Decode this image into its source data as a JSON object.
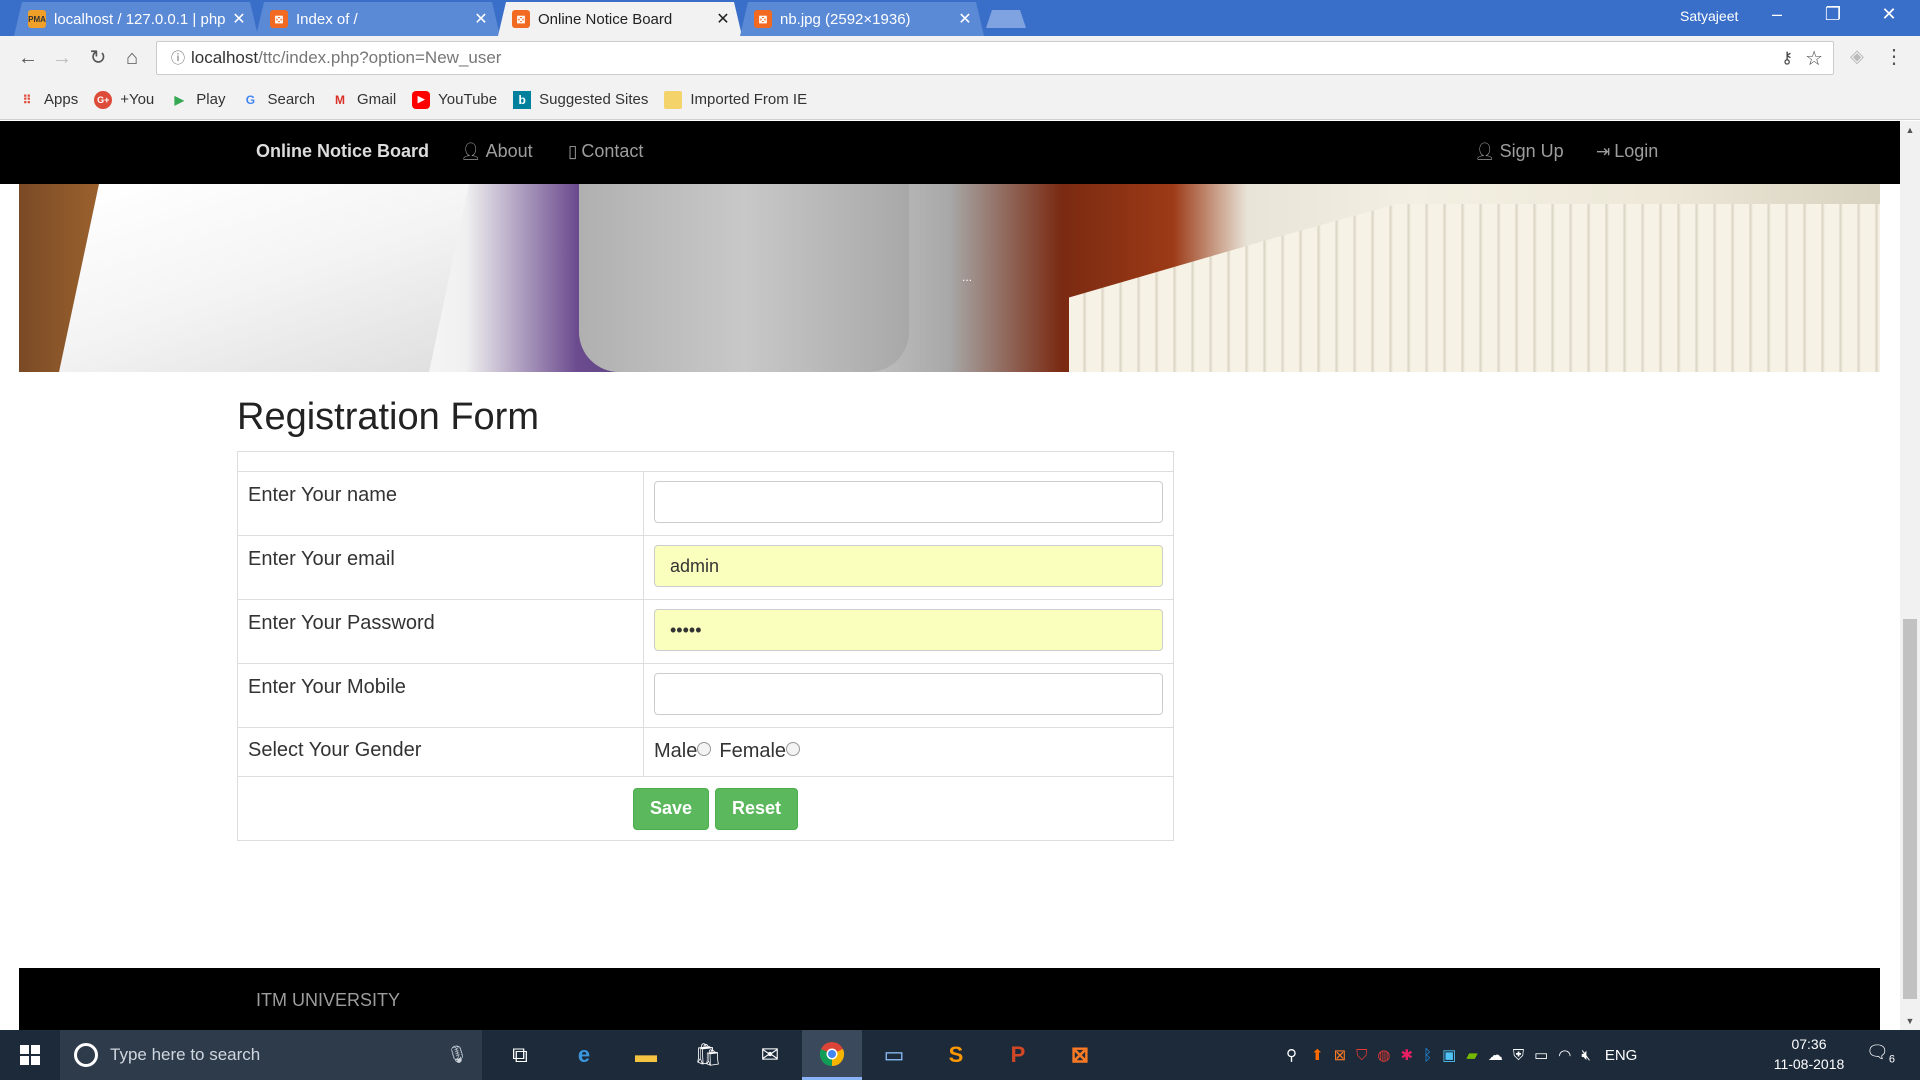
{
  "browser": {
    "tabs": [
      {
        "title": "localhost / 127.0.0.1 | php",
        "favicon": "phpmyadmin-icon",
        "active": false
      },
      {
        "title": "Index of /",
        "favicon": "xampp-icon",
        "active": false
      },
      {
        "title": "Online Notice Board",
        "favicon": "xampp-icon",
        "active": true
      },
      {
        "title": "nb.jpg (2592×1936)",
        "favicon": "xampp-icon",
        "active": false
      }
    ],
    "profile_name": "Satyajeet",
    "url_host": "localhost",
    "url_path": "/ttc/index.php?option=New_user",
    "bookmarks": [
      {
        "label": "Apps",
        "icon": "apps-grid-icon",
        "color": "#e04a3a"
      },
      {
        "label": "+You",
        "icon": "google-plus-icon",
        "color": "#dd4b39"
      },
      {
        "label": "Play",
        "icon": "play-store-icon",
        "color": "#34a853"
      },
      {
        "label": "Search",
        "icon": "google-g-icon",
        "color": "#4285f4"
      },
      {
        "label": "Gmail",
        "icon": "gmail-icon",
        "color": "#d93025"
      },
      {
        "label": "YouTube",
        "icon": "youtube-icon",
        "color": "#ff0000"
      },
      {
        "label": "Suggested Sites",
        "icon": "bing-icon",
        "color": "#00809d"
      },
      {
        "label": "Imported From IE",
        "icon": "folder-icon",
        "color": "#f5d36b"
      }
    ]
  },
  "site": {
    "brand": "Online Notice Board",
    "nav_left": [
      {
        "label": "About",
        "icon": "user-icon"
      },
      {
        "label": "Contact",
        "icon": "mobile-icon"
      }
    ],
    "nav_right": [
      {
        "label": "Sign Up",
        "icon": "user-icon"
      },
      {
        "label": "Login",
        "icon": "login-icon"
      }
    ],
    "hero_caption": "...",
    "form_title": "Registration Form",
    "fields": [
      {
        "label": "Enter Your name",
        "value": "",
        "autofilled": false
      },
      {
        "label": "Enter Your email",
        "value": "admin",
        "autofilled": true
      },
      {
        "label": "Enter Your Password",
        "value": "•••••",
        "autofilled": true
      },
      {
        "label": "Enter Your Mobile",
        "value": "",
        "autofilled": false
      }
    ],
    "gender_label": "Select Your Gender",
    "gender_options": [
      "Male",
      "Female"
    ],
    "save_label": "Save",
    "reset_label": "Reset",
    "footer_text": "ITM UNIVERSITY",
    "accent_green": "#5cb85c",
    "autofill_yellow": "#faffbd"
  },
  "taskbar": {
    "search_placeholder": "Type here to search",
    "language": "ENG",
    "time": "07:36",
    "date": "11-08-2018",
    "notification_count": "6"
  }
}
